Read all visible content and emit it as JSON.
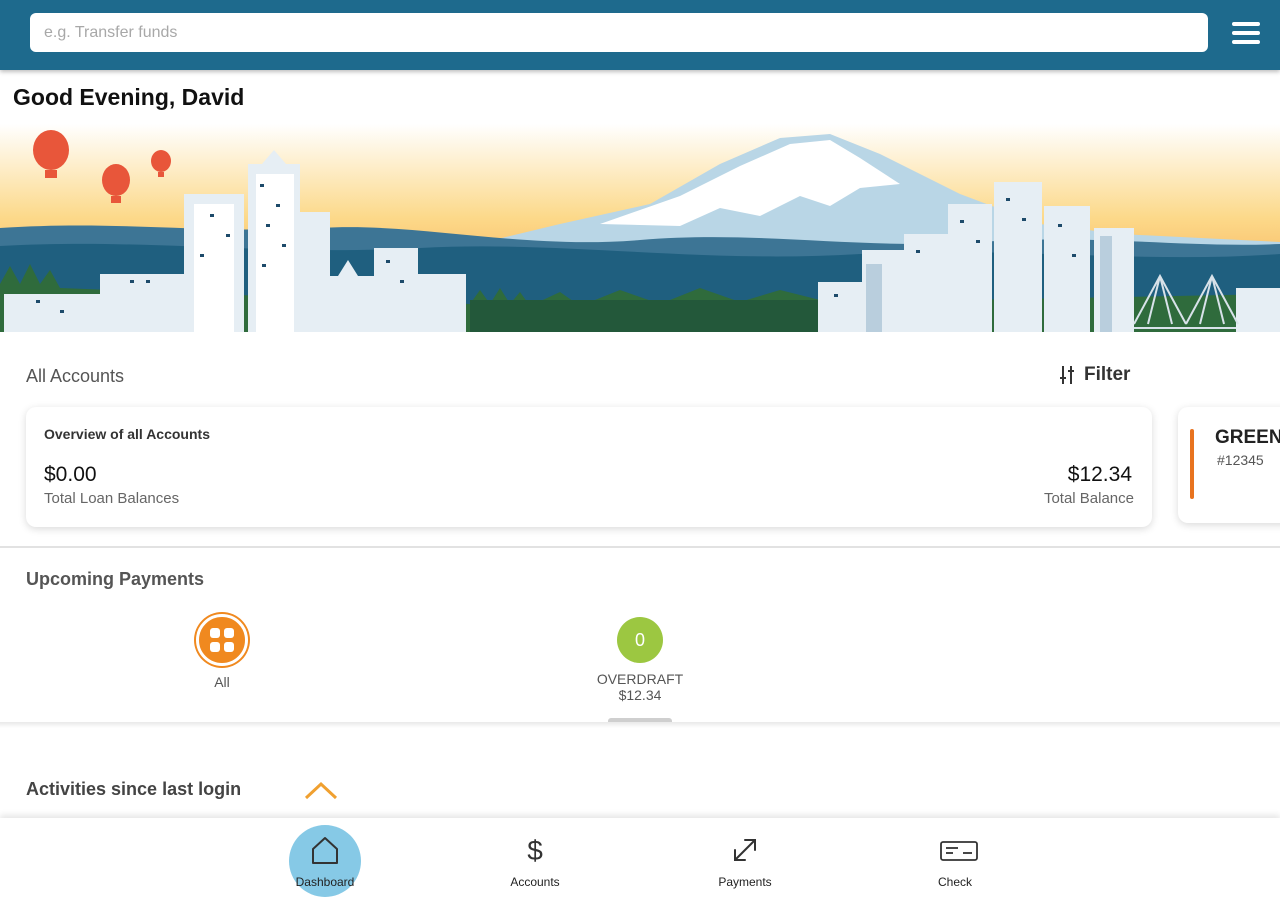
{
  "search": {
    "placeholder": "e.g. Transfer funds"
  },
  "header": {
    "menu_icon": "hamburger-menu-icon"
  },
  "greeting": "Good Evening, David",
  "accounts": {
    "section_title": "All Accounts",
    "filter_label": "Filter",
    "overview_card": {
      "title": "Overview of all Accounts",
      "loan_amount": "$0.00",
      "loan_label": "Total Loan Balances",
      "balance_amount": "$12.34",
      "balance_label": "Total Balance"
    },
    "account_card": {
      "name": "GREEN",
      "number": "#12345",
      "accent_color": "#e8731f"
    }
  },
  "upcoming_payments": {
    "section_title": "Upcoming Payments",
    "items": [
      {
        "label": "All",
        "icon": "grid-icon",
        "color": "#f0891f"
      },
      {
        "badge": "0",
        "label": "OVERDRAFT",
        "amount": "$12.34",
        "color": "#9cc741"
      }
    ]
  },
  "activities": {
    "section_title": "Activities since last login"
  },
  "bottom_nav": [
    {
      "label": "Dashboard",
      "icon": "home-icon",
      "active": true
    },
    {
      "label": "Accounts",
      "icon": "dollar-icon"
    },
    {
      "label": "Payments",
      "icon": "transfer-arrows-icon"
    },
    {
      "label": "Check",
      "icon": "check-icon"
    }
  ],
  "colors": {
    "header": "#1e6a8d",
    "accent_orange": "#f0891f",
    "accent_green": "#9cc741",
    "nav_active": "#86c9e6"
  }
}
